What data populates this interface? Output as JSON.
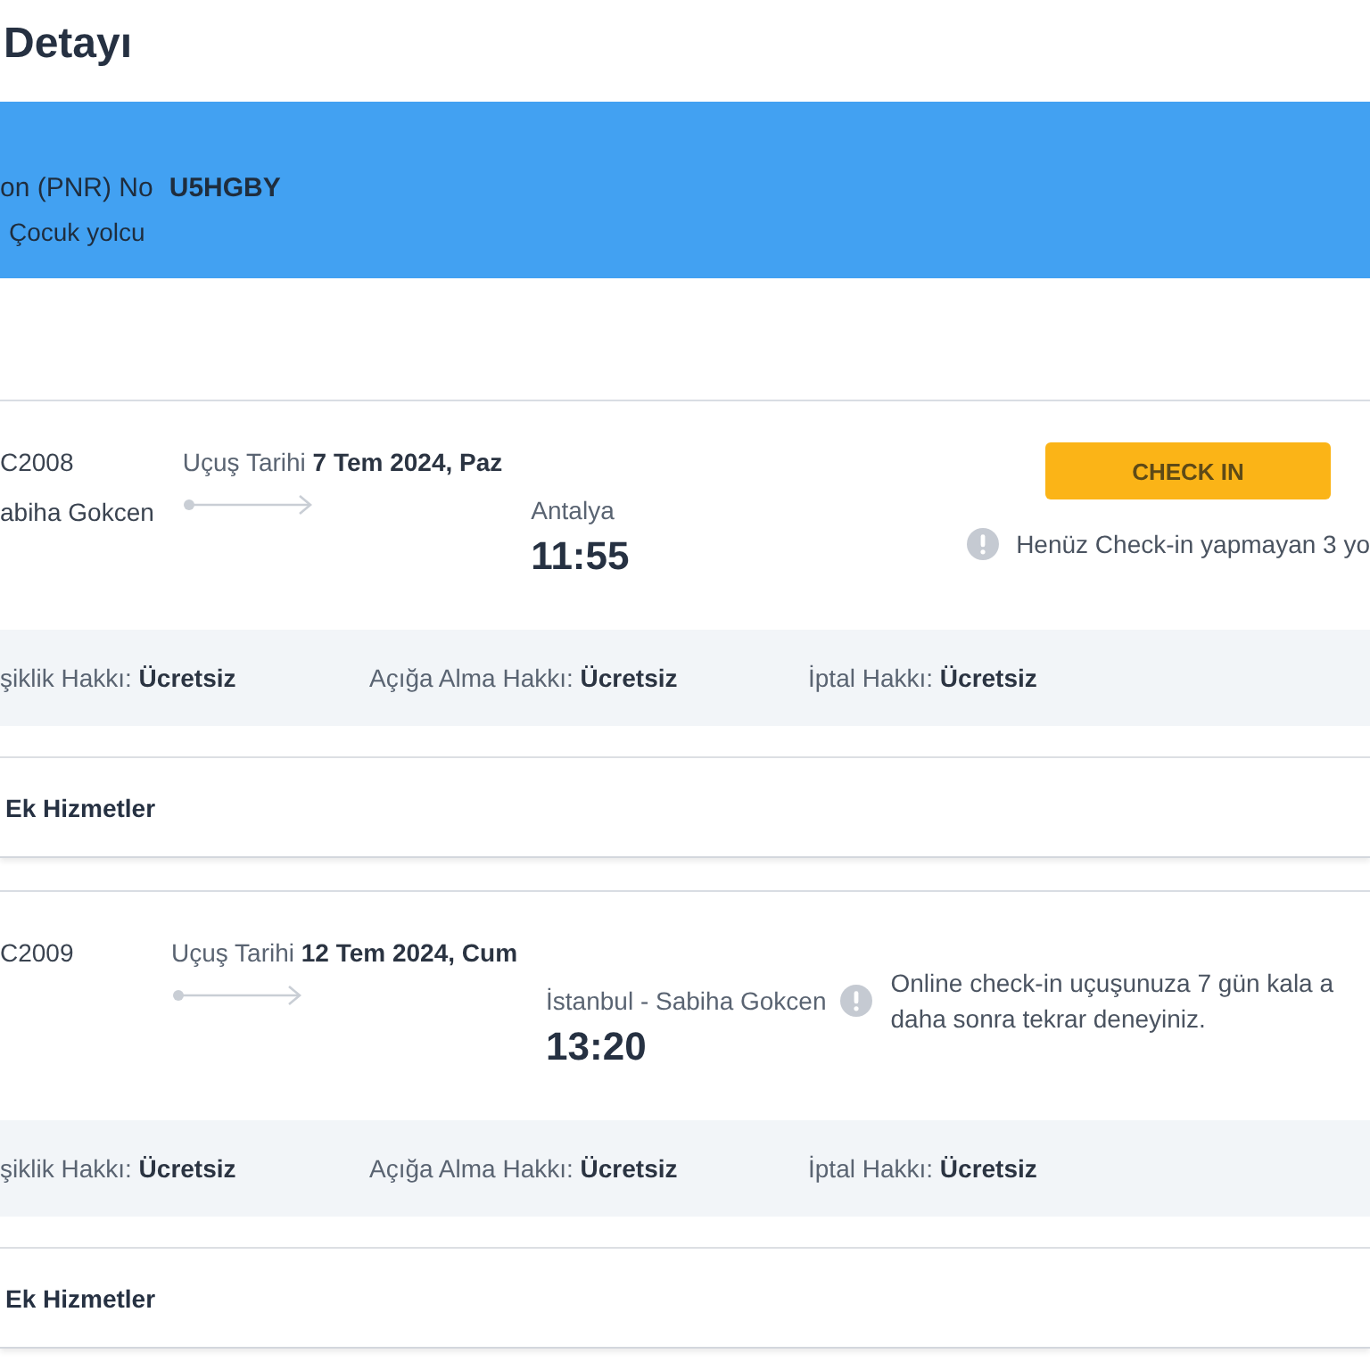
{
  "page": {
    "title": "Detayı"
  },
  "booking_banner": {
    "pnr_label": "on (PNR) No",
    "pnr_value": "U5HGBY",
    "passengers": "Çocuk yolcu"
  },
  "flights": [
    {
      "flight_no": "C2008",
      "departure_city": "abiha Gokcen",
      "date_label": "Uçuş Tarihi",
      "date": "7 Tem 2024, Paz",
      "arrival_city": "Antalya",
      "arrival_time": "11:55",
      "checkin_button": "CHECK IN",
      "notice": {
        "kind": "under-button",
        "lines": [
          "Henüz Check-in yapmayan 3 yo"
        ]
      },
      "rights": [
        {
          "label": "şiklik Hakkı:",
          "value": "Ücretsiz"
        },
        {
          "label": "Açığa Alma Hakkı:",
          "value": "Ücretsiz"
        },
        {
          "label": "İptal Hakkı:",
          "value": "Ücretsiz"
        }
      ],
      "extras_label": "Ek Hizmetler"
    },
    {
      "flight_no": "C2009",
      "date_label": "Uçuş Tarihi",
      "date": "12 Tem 2024, Cum",
      "arrival_city": "İstanbul - Sabiha Gokcen",
      "arrival_time": "13:20",
      "notice": {
        "kind": "beside-arrival",
        "lines": [
          "Online check-in uçuşunuza 7 gün kala a",
          "daha sonra tekrar deneyiniz."
        ]
      },
      "rights": [
        {
          "label": "şiklik Hakkı:",
          "value": "Ücretsiz"
        },
        {
          "label": "Açığa Alma Hakkı:",
          "value": "Ücretsiz"
        },
        {
          "label": "İptal Hakkı:",
          "value": "Ücretsiz"
        }
      ],
      "extras_label": "Ek Hizmetler"
    }
  ]
}
